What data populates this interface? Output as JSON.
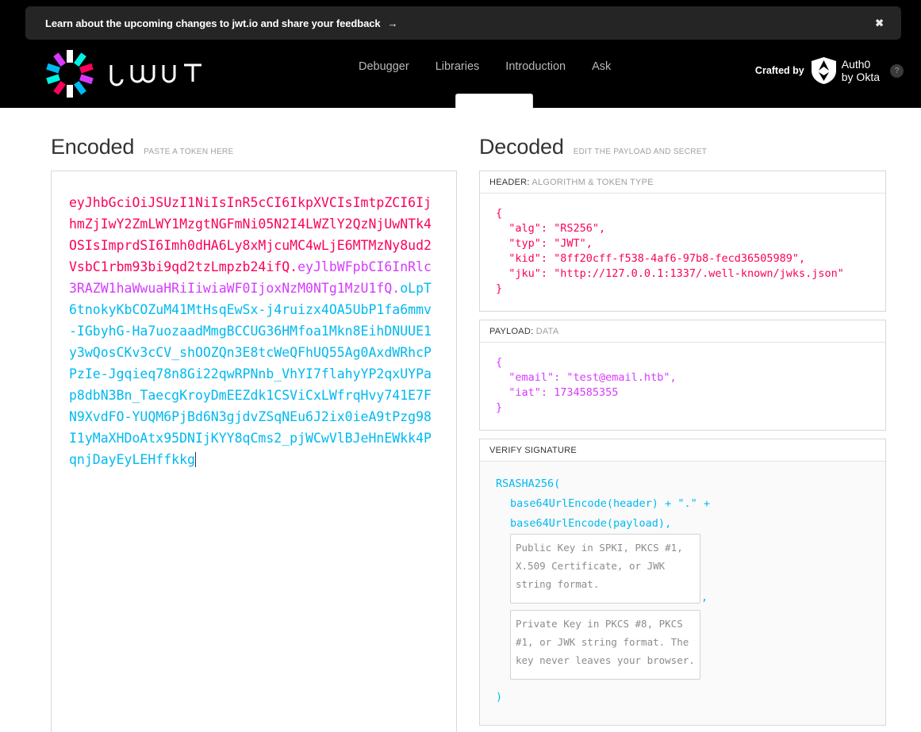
{
  "banner": {
    "message": "Learn about the upcoming changes to jwt.io and share your feedback",
    "arrow": "→",
    "close_label": "✖"
  },
  "header": {
    "brand_name": "JWT",
    "nav": [
      {
        "label": "Debugger"
      },
      {
        "label": "Libraries"
      },
      {
        "label": "Introduction"
      },
      {
        "label": "Ask"
      }
    ],
    "crafted_by_label": "Crafted by",
    "auth0_line1": "Auth0",
    "auth0_line2": "by Okta",
    "help_label": "?"
  },
  "encoded": {
    "title": "Encoded",
    "subtitle": "PASTE A TOKEN HERE",
    "token_header": "eyJhbGciOiJSUzI1NiIsInR5cCI6IkpXVCIsImtpZCI6IjhmZjIwY2ZmLWY1MzgtNGFmNi05N2I4LWZlY2QzNjUwNTk4OSIsImprdSI6Imh0dHA6Ly8xMjcuMC4wLjE6MTMzNy8ud2VsbC1rbm93bi9qd2tzLmpzb24ifQ",
    "token_payload": "eyJlbWFpbCI6InRlc3RAZW1haWwuaHRiIiwiaWF0IjoxNzM0NTg1MzU1fQ",
    "token_signature": "oLpT6tnokyKbCOZuM41MtHsqEwSx-j4ruizx4OA5UbP1fa6mmv-IGbyhG-Ha7uozaadMmgBCCUG36HMfoa1Mkn8EihDNUUE1y3wQosCKv3cCV_shOOZQn3E8tcWeQFhUQ55Ag0AxdWRhcPPzIe-Jgqieq78n8Gi22qwRPNnb_VhYI7flahyYP2qxUYPap8dbN3Bn_TaecgKroyDmEEZdk1CSViCxLWfrqHvy741E7FN9XvdFO-YUQM6PjBd6N3gjdvZSqNEu6J2ix0ieA9tPzg98I1yMaXHDoAtx95DNIjKYY8qCms2_pjWCwVlBJeHnEWkk4PqnjDayEyLEHffkkg",
    "dot": "."
  },
  "decoded": {
    "title": "Decoded",
    "subtitle": "EDIT THE PAYLOAD AND SECRET",
    "header_panel": {
      "label_strong": "HEADER:",
      "label_dim": "ALGORITHM & TOKEN TYPE",
      "json": "{\n  \"alg\": \"RS256\",\n  \"typ\": \"JWT\",\n  \"kid\": \"8ff20cff-f538-4af6-97b8-fecd36505989\",\n  \"jku\": \"http://127.0.0.1:1337/.well-known/jwks.json\"\n}"
    },
    "payload_panel": {
      "label_strong": "PAYLOAD:",
      "label_dim": "DATA",
      "json": "{\n  \"email\": \"test@email.htb\",\n  \"iat\": 1734585355\n}"
    },
    "signature_panel": {
      "label_strong": "VERIFY SIGNATURE",
      "label_dim": "",
      "line1": "RSASHA256(",
      "line2": "base64UrlEncode(header) + \".\" +",
      "line3": "base64UrlEncode(payload),",
      "public_key_placeholder": "Public Key in SPKI, PKCS #1, X.509 Certificate, or JWK string format.",
      "public_key_value": "",
      "separator_comma": ",",
      "private_key_placeholder": "Private Key in PKCS #8, PKCS #1, or JWK string format. The key never leaves your browser.",
      "private_key_value": "",
      "line_close": ")"
    }
  },
  "colors": {
    "header_segment": "#fb015b",
    "payload_segment": "#d63aff",
    "signature_segment": "#00b9f1",
    "topbar_bg": "#000000",
    "banner_bg": "#252525"
  }
}
